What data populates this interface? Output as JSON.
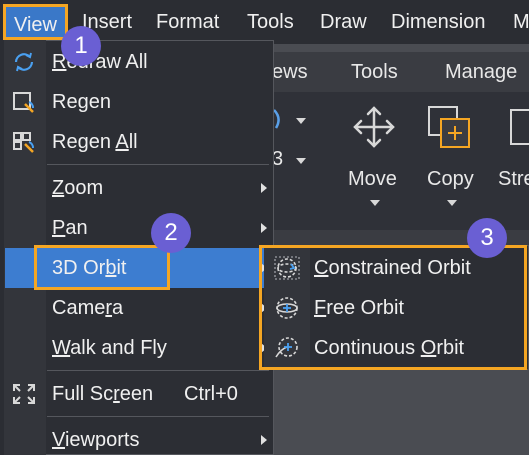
{
  "menubar": {
    "items": [
      {
        "label": "View"
      },
      {
        "label": "Insert"
      },
      {
        "label": "Format"
      },
      {
        "label": "Tools"
      },
      {
        "label": "Draw"
      },
      {
        "label": "Dimension"
      },
      {
        "label": "M"
      }
    ]
  },
  "ribbon": {
    "tabs": [
      {
        "label": "ews"
      },
      {
        "label": "Tools"
      },
      {
        "label": "Manage"
      }
    ],
    "buttons": [
      {
        "label": "Move",
        "icon": "move-arrows-icon"
      },
      {
        "label": "Copy",
        "icon": "copy-icon"
      },
      {
        "label": "Stre",
        "icon": "stretch-icon"
      }
    ],
    "partial_number": "3"
  },
  "view_menu": {
    "items": [
      {
        "label_pre": "",
        "label_ul": "R",
        "label_post": "edraw All",
        "icon": "redraw-icon"
      },
      {
        "label_pre": "Re",
        "label_ul": "g",
        "label_post": "en",
        "icon": "regen-icon"
      },
      {
        "label_pre": "Regen ",
        "label_ul": "A",
        "label_post": "ll",
        "icon": "regen-all-icon"
      },
      {
        "label_pre": "",
        "label_ul": "Z",
        "label_post": "oom",
        "submenu": true
      },
      {
        "label_pre": "",
        "label_ul": "P",
        "label_post": "an",
        "submenu": true
      },
      {
        "label_pre": "3D Or",
        "label_ul": "b",
        "label_post": "it",
        "submenu": true
      },
      {
        "label_pre": "Came",
        "label_ul": "r",
        "label_post": "a",
        "submenu": true
      },
      {
        "label_pre": "",
        "label_ul": "W",
        "label_post": "alk and Fly",
        "submenu": true
      },
      {
        "label_pre": "Full Sc",
        "label_ul": "r",
        "label_post": "een",
        "shortcut": "Ctrl+0",
        "icon": "fullscreen-icon"
      },
      {
        "label_pre": "",
        "label_ul": "V",
        "label_post": "iewports",
        "submenu": true
      }
    ]
  },
  "orbit_submenu": {
    "items": [
      {
        "label_pre": "",
        "label_ul": "C",
        "label_post": "onstrained Orbit",
        "icon": "constrained-orbit-icon"
      },
      {
        "label_pre": "",
        "label_ul": "F",
        "label_post": "ree Orbit",
        "icon": "free-orbit-icon"
      },
      {
        "label_pre": "Continuous ",
        "label_ul": "O",
        "label_post": "rbit",
        "icon": "continuous-orbit-icon"
      }
    ]
  },
  "badges": [
    {
      "label": "1"
    },
    {
      "label": "2"
    },
    {
      "label": "3"
    }
  ],
  "colors": {
    "highlight": "#3d7dd0",
    "callout_border": "#f5a623",
    "badge": "#6a5fd3",
    "menu_bg": "#2c2e34"
  }
}
